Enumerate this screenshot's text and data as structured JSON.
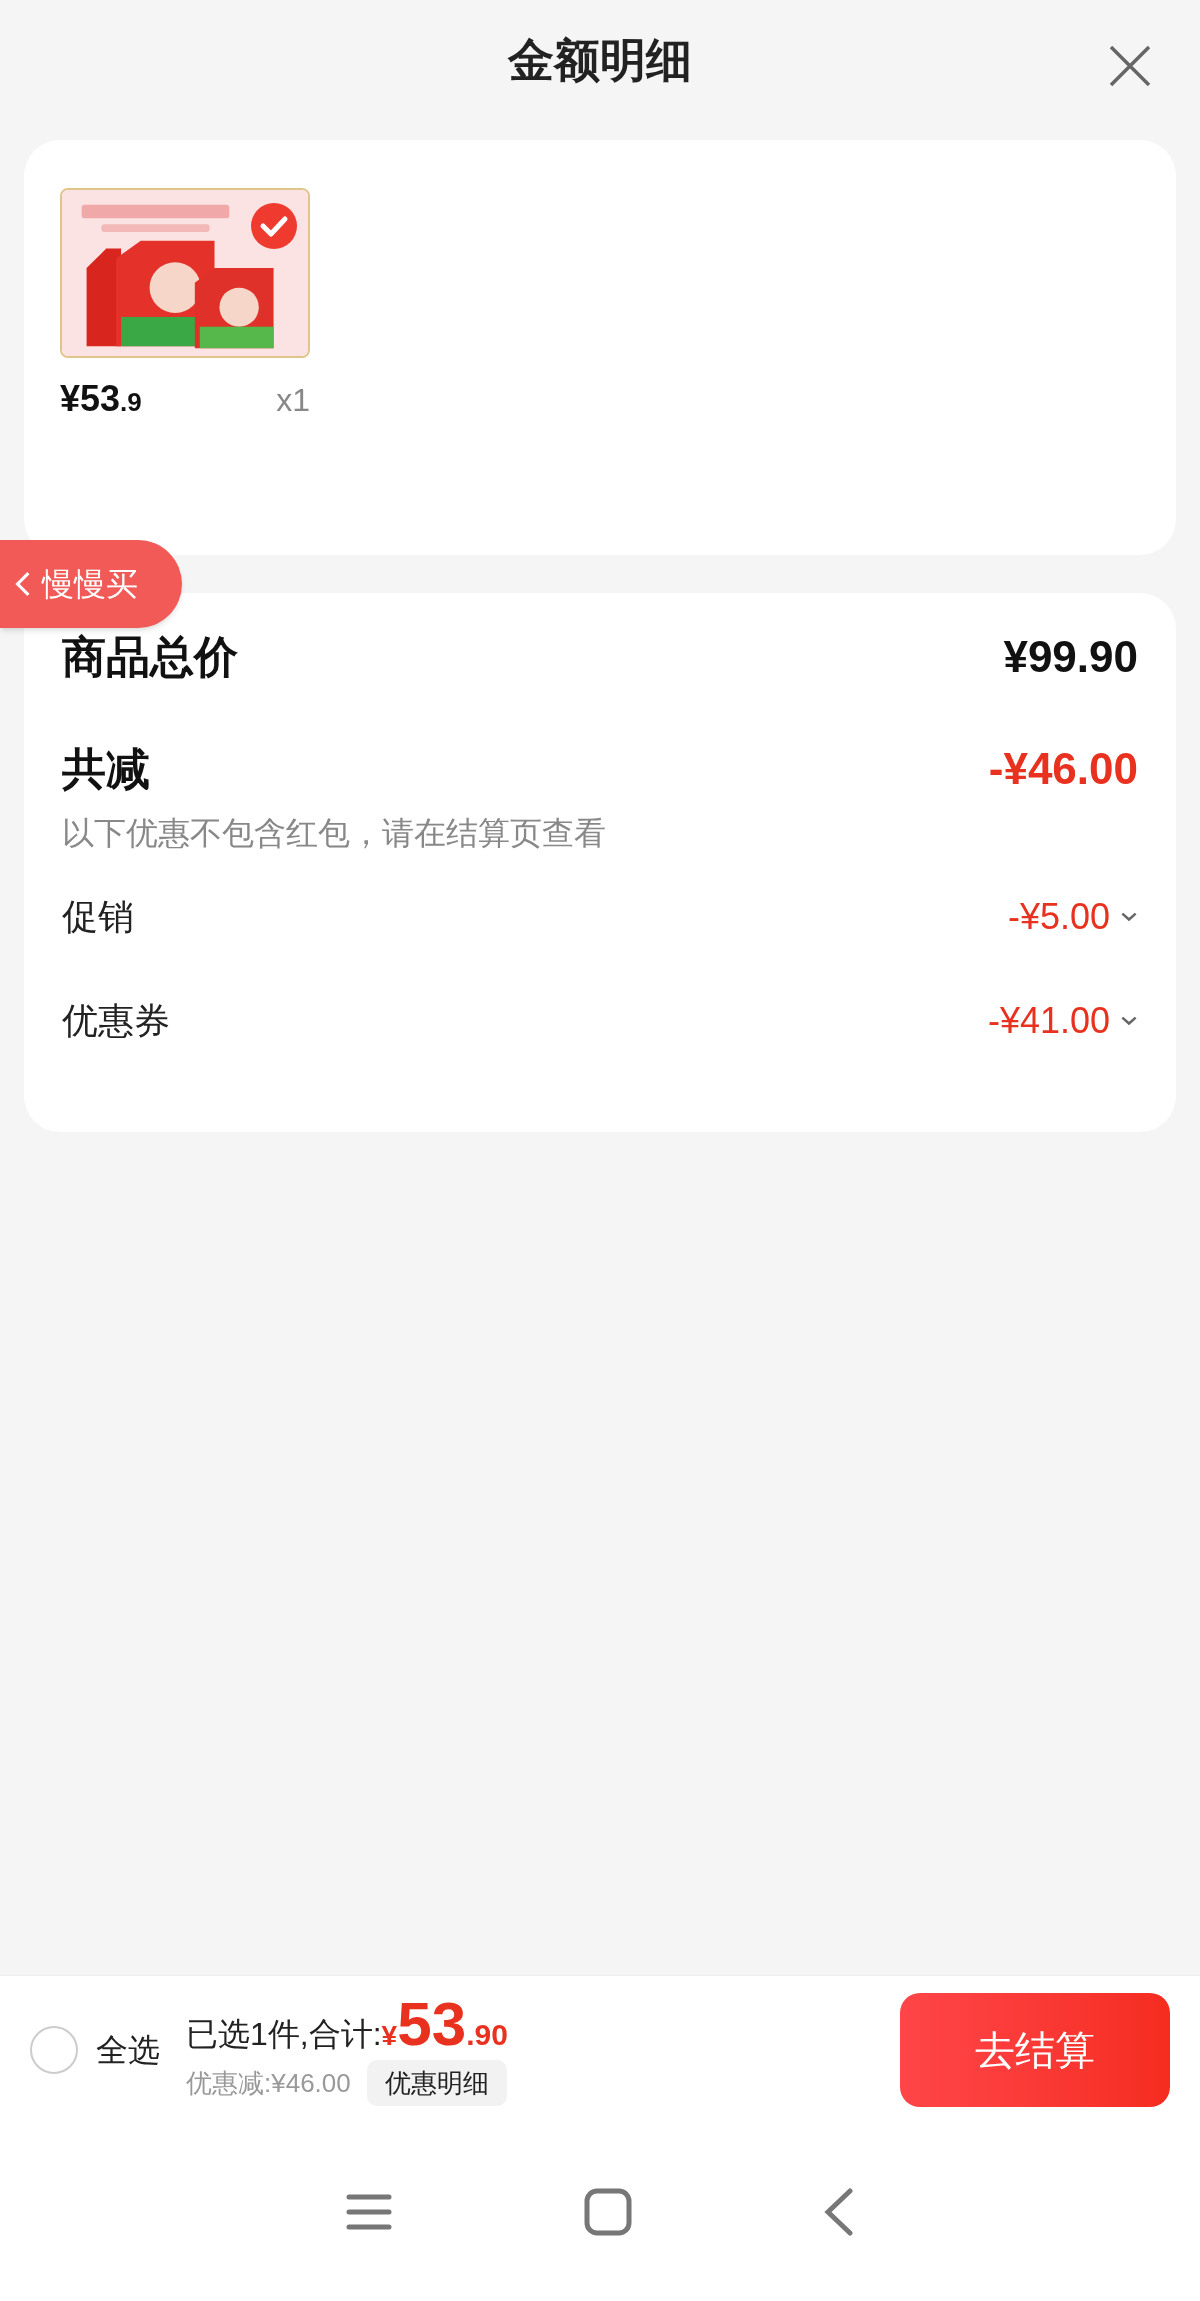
{
  "header": {
    "title": "金额明细"
  },
  "product": {
    "checked": true,
    "price_integer": "¥53",
    "price_decimal": ".9",
    "quantity": "x1"
  },
  "floating_button": {
    "label": "慢慢买"
  },
  "summary": {
    "total_label": "商品总价",
    "total_value": "¥99.90",
    "reduction_label": "共减",
    "reduction_value": "-¥46.00",
    "note": "以下优惠不包含红包，请在结算页查看",
    "discounts": [
      {
        "label": "促销",
        "value": "-¥5.00",
        "expanded": false
      },
      {
        "label": "优惠券",
        "value": "-¥41.00",
        "expanded": false
      }
    ]
  },
  "footer": {
    "select_all": {
      "label": "全选",
      "checked": false
    },
    "selected_text": "已选1件,合计:",
    "currency": "¥",
    "total_integer": "53",
    "total_decimal": ".90",
    "saved_text": "优惠减:¥46.00",
    "detail_button": "优惠明细",
    "checkout_button": "去结算"
  }
}
